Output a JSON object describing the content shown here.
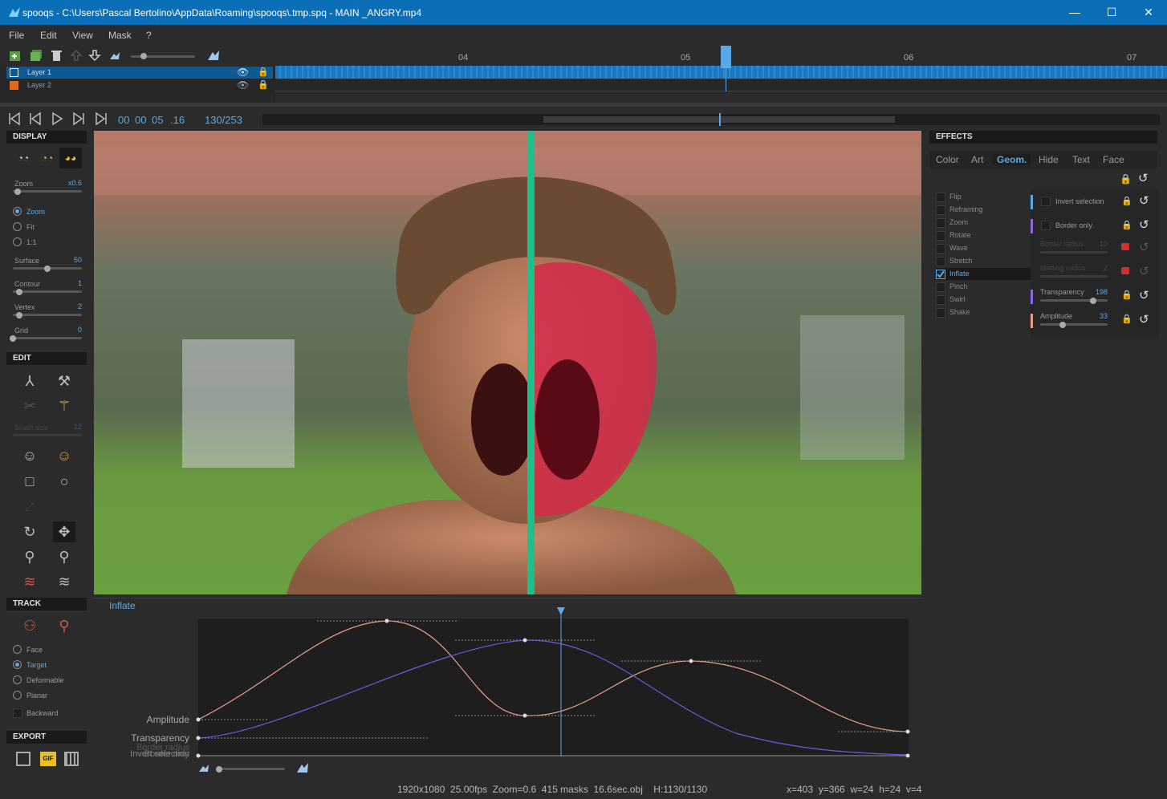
{
  "titlebar": {
    "app": "spooqs",
    "path": "C:\\Users\\Pascal Bertolino\\AppData\\Roaming\\spooqs\\.tmp.spq - MAIN _ANGRY.mp4",
    "minimize": "—",
    "maximize": "☐",
    "close": "✕"
  },
  "menu": [
    "File",
    "Edit",
    "View",
    "Mask",
    "?"
  ],
  "timeline": {
    "ticks": [
      "04",
      "05",
      "06",
      "07"
    ],
    "layers": [
      {
        "name": "Layer 1",
        "color": "#0b6fb8"
      },
      {
        "name": "Layer 2",
        "color": "#e06a1a"
      }
    ]
  },
  "transport": {
    "hh": "00",
    "mm": "00",
    "ss": "05",
    "ff": ".16",
    "frame": "130/253"
  },
  "display": {
    "header": "DISPLAY",
    "zoom_label": "Zoom",
    "zoom_value": "x0.6",
    "radios": [
      "Zoom",
      "Fit",
      "1:1"
    ],
    "radio_selected": 0,
    "surface_label": "Surface",
    "surface_value": "50",
    "contour_label": "Contour",
    "contour_value": "1",
    "vertex_label": "Vertex",
    "vertex_value": "2",
    "grid_label": "Grid",
    "grid_value": "0"
  },
  "edit": {
    "header": "EDIT",
    "brush_label": "Brush size",
    "brush_value": "12"
  },
  "track": {
    "header": "TRACK",
    "radios": [
      "Face",
      "Target",
      "Deformable",
      "Planar"
    ],
    "radio_selected": 1,
    "backward": "Backward"
  },
  "export": {
    "header": "EXPORT",
    "gif": "GIF"
  },
  "effects": {
    "header": "EFFECTS",
    "tabs": [
      "Color",
      "Art",
      "Geom.",
      "Hide",
      "Text",
      "Face"
    ],
    "active_tab": 2,
    "list": [
      "Flip",
      "Reframing",
      "Zoom",
      "Rotate",
      "Wave",
      "Stretch",
      "Inflate",
      "Pinch",
      "Swirl",
      "Shake"
    ],
    "checked": 6,
    "params": [
      {
        "label": "Invert selection",
        "type": "check",
        "color": "#5aa9e6"
      },
      {
        "label": "Border only",
        "type": "check",
        "color": "#8a6ad8"
      },
      {
        "label": "Border radius",
        "value": "10",
        "type": "slider",
        "disabled": true
      },
      {
        "label": "Matting radius",
        "value": "2",
        "type": "slider",
        "disabled": true
      },
      {
        "label": "Transparency",
        "value": "198",
        "type": "slider",
        "color": "#8a6ad8",
        "level": 0.78
      },
      {
        "label": "Amplitude",
        "value": "33",
        "type": "slider",
        "color": "#e8a08a",
        "level": 0.33
      }
    ]
  },
  "curve": {
    "title": "Inflate",
    "labels": [
      "Amplitude",
      "Transparency",
      "Invert selection",
      "Border radius",
      "Border only"
    ]
  },
  "status": {
    "left": "1920x1080  25.00fps  Zoom=0.6  415 masks  16.6sec.obj    H:1130/1130",
    "right": "x=403  y=366  w=24  h=24  v=4"
  }
}
